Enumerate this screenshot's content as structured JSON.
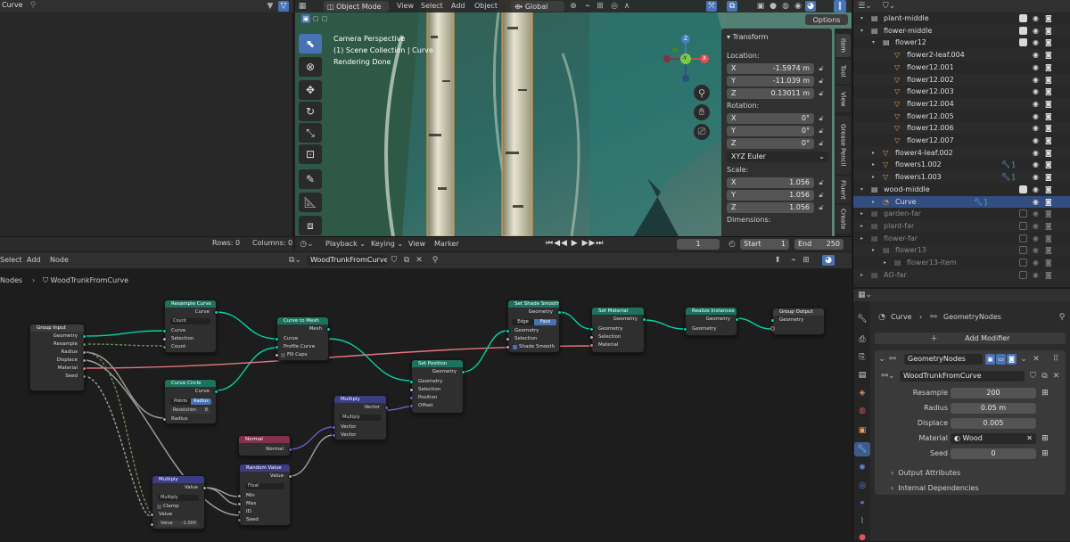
{
  "spreadsheet": {
    "object": "Curve",
    "rows_label": "Rows: 0",
    "columns_label": "Columns: 0"
  },
  "viewport": {
    "mode": "Object Mode",
    "menus": [
      "View",
      "Select",
      "Add",
      "Object"
    ],
    "orientation": "Global",
    "options": "Options",
    "overlay_lines": [
      "Camera Perspective",
      "(1) Scene Collection | Curve",
      "Rendering Done"
    ],
    "tabs": [
      "Item",
      "Tool",
      "View",
      "Grease Pencil",
      "Fluent",
      "Create"
    ],
    "gizmo": {
      "z": "Z",
      "y": "-Y",
      "x": "X"
    }
  },
  "transform": {
    "title": "Transform",
    "location_label": "Location:",
    "location": [
      {
        "axis": "X",
        "value": "-1.5974 m"
      },
      {
        "axis": "Y",
        "value": "-11.039 m"
      },
      {
        "axis": "Z",
        "value": "0.13011 m"
      }
    ],
    "rotation_label": "Rotation:",
    "rotation": [
      {
        "axis": "X",
        "value": "0°"
      },
      {
        "axis": "Y",
        "value": "0°"
      },
      {
        "axis": "Z",
        "value": "0°"
      }
    ],
    "rotation_mode": "XYZ Euler",
    "scale_label": "Scale:",
    "scale": [
      {
        "axis": "X",
        "value": "1.056"
      },
      {
        "axis": "Y",
        "value": "1.056"
      },
      {
        "axis": "Z",
        "value": "1.056"
      }
    ],
    "dimensions_label": "Dimensions:"
  },
  "timeline": {
    "menus": [
      "Playback",
      "Keying",
      "View",
      "Marker"
    ],
    "current": "1",
    "start_label": "Start",
    "start": "1",
    "end_label": "End",
    "end": "250"
  },
  "node_editor": {
    "menus": [
      "Select",
      "Add",
      "Node"
    ],
    "tree_name": "WoodTrunkFromCurve",
    "breadcrumb_root": "Nodes",
    "breadcrumb_tree": "WoodTrunkFromCurve",
    "nodes": {
      "group_input": {
        "title": "Group Input",
        "outputs": [
          "Geometry",
          "Resample",
          "Radius",
          "Displace",
          "Material",
          "Seed"
        ]
      },
      "resample": {
        "title": "Resample Curve",
        "out": "Curve",
        "mode": "Count",
        "inputs": [
          "Curve",
          "Selection",
          "Count"
        ]
      },
      "curve_circle": {
        "title": "Curve Circle",
        "out": "Curve",
        "modes": [
          "Points",
          "Radius"
        ],
        "resolution_label": "Resolution",
        "resolution": "8",
        "inputs": [
          "Radius"
        ]
      },
      "curve_to_mesh": {
        "title": "Curve to Mesh",
        "out": "Mesh",
        "inputs": [
          "Curve",
          "Profile Curve",
          "Fill Caps"
        ]
      },
      "set_position": {
        "title": "Set Position",
        "out": "Geometry",
        "inputs": [
          "Geometry",
          "Selection",
          "Position",
          "Offset"
        ]
      },
      "set_shade_smooth": {
        "title": "Set Shade Smooth",
        "out": "Geometry",
        "modes": [
          "Edge",
          "Face"
        ],
        "inputs": [
          "Geometry",
          "Selection",
          "Shade Smooth"
        ]
      },
      "set_material": {
        "title": "Set Material",
        "out": "Geometry",
        "inputs": [
          "Geometry",
          "Selection",
          "Material"
        ]
      },
      "realize": {
        "title": "Realize Instances",
        "out": "Geometry",
        "inputs": [
          "Geometry"
        ]
      },
      "group_output": {
        "title": "Group Output",
        "inputs": [
          "Geometry"
        ]
      },
      "multiply_vec": {
        "title": "Multiply",
        "out": "Vector",
        "mode": "Multiply",
        "inputs": [
          "Vector",
          "Vector"
        ]
      },
      "normal": {
        "title": "Normal",
        "out": "Normal"
      },
      "random_value": {
        "title": "Random Value",
        "out": "Value",
        "type": "Float",
        "inputs": [
          "Min",
          "Max",
          "ID",
          "Seed"
        ]
      },
      "multiply_flt": {
        "title": "Multiply",
        "out": "Value",
        "mode": "Multiply",
        "clamp": "Clamp",
        "inputs": [
          "Value"
        ],
        "value_label": "Value",
        "value": "-1.000"
      }
    }
  },
  "outliner": {
    "rows": [
      {
        "name": "plant-middle",
        "indent": 0,
        "kind": "collection",
        "checked": true
      },
      {
        "name": "flower-middle",
        "indent": 0,
        "kind": "collection",
        "checked": true
      },
      {
        "name": "flower12",
        "indent": 1,
        "kind": "collection",
        "checked": true
      },
      {
        "name": "flower2-leaf.004",
        "indent": 2,
        "kind": "object"
      },
      {
        "name": "flower12.001",
        "indent": 2,
        "kind": "object"
      },
      {
        "name": "flower12.002",
        "indent": 2,
        "kind": "object"
      },
      {
        "name": "flower12.003",
        "indent": 2,
        "kind": "object"
      },
      {
        "name": "flower12.004",
        "indent": 2,
        "kind": "object"
      },
      {
        "name": "flower12.005",
        "indent": 2,
        "kind": "object"
      },
      {
        "name": "flower12.006",
        "indent": 2,
        "kind": "object"
      },
      {
        "name": "flower12.007",
        "indent": 2,
        "kind": "object"
      },
      {
        "name": "flower4-leaf.002",
        "indent": 1,
        "kind": "object"
      },
      {
        "name": "flowers1.002",
        "indent": 1,
        "kind": "object"
      },
      {
        "name": "flowers1.003",
        "indent": 1,
        "kind": "object"
      },
      {
        "name": "wood-middle",
        "indent": 0,
        "kind": "collection",
        "checked": true
      },
      {
        "name": "Curve",
        "indent": 1,
        "kind": "selected"
      },
      {
        "name": "garden-far",
        "indent": 0,
        "kind": "collection-off"
      },
      {
        "name": "plant-far",
        "indent": 0,
        "kind": "collection-off"
      },
      {
        "name": "flower-far",
        "indent": 0,
        "kind": "collection-off"
      },
      {
        "name": "flower13",
        "indent": 1,
        "kind": "collection-off"
      },
      {
        "name": "flower13-item",
        "indent": 2,
        "kind": "collection-off"
      },
      {
        "name": "AO-far",
        "indent": 0,
        "kind": "collection-off"
      }
    ]
  },
  "properties": {
    "object": "Curve",
    "modifier_tab": "GeometryNodes",
    "add_modifier": "Add Modifier",
    "modifier_name": "GeometryNodes",
    "node_group": "WoodTrunkFromCurve",
    "params": [
      {
        "label": "Resample",
        "value": "200"
      },
      {
        "label": "Radius",
        "value": "0.05 m"
      },
      {
        "label": "Displace",
        "value": "0.005"
      },
      {
        "label": "Material",
        "value": "Wood"
      },
      {
        "label": "Seed",
        "value": "0"
      }
    ],
    "panels": [
      "Output Attributes",
      "Internal Dependencies"
    ]
  }
}
